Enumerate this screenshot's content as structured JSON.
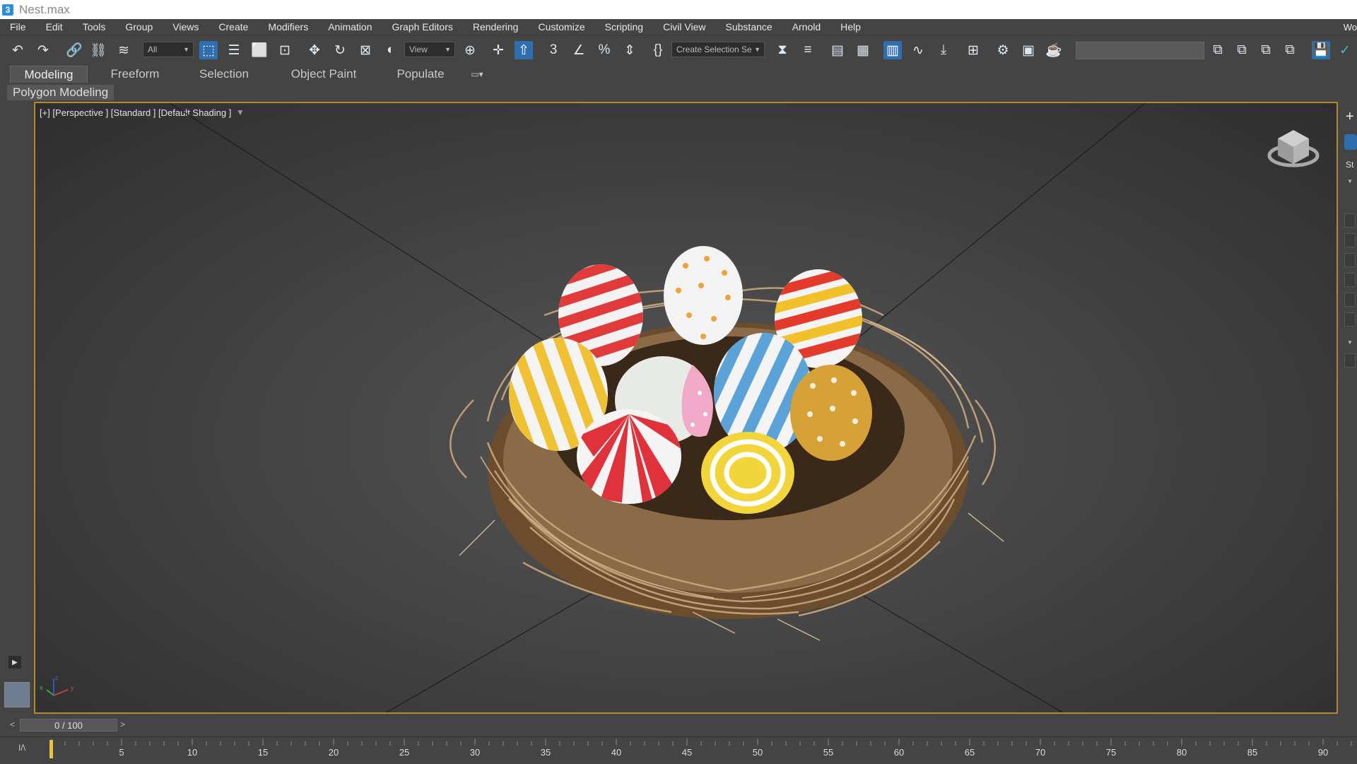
{
  "window": {
    "title": "Nest.max",
    "icon_glyph": "3"
  },
  "menu": {
    "items": [
      "File",
      "Edit",
      "Tools",
      "Group",
      "Views",
      "Create",
      "Modifiers",
      "Animation",
      "Graph Editors",
      "Rendering",
      "Customize",
      "Scripting",
      "Civil View",
      "Substance",
      "Arnold",
      "Help"
    ],
    "overflow": "Wo"
  },
  "toolbar": {
    "filter_select": "All",
    "reference_coord": "View",
    "named_selection": "Create Selection Se",
    "icons": [
      "undo-icon",
      "redo-icon",
      "link-icon",
      "unlink-icon",
      "bind-space-warp-icon",
      "select-object-icon",
      "select-by-name-icon",
      "rect-selection-region-icon",
      "window-crossing-icon",
      "select-move-icon",
      "select-rotate-icon",
      "select-scale-icon",
      "select-place-icon",
      "select-manipulate-icon",
      "keyboard-shortcut-override-icon",
      "snaps-toggle-icon",
      "angle-snap-icon",
      "percent-snap-icon",
      "spinner-snap-icon",
      "edit-named-selection-icon",
      "mirror-icon",
      "align-icon",
      "scene-explorer-icon",
      "layer-explorer-icon",
      "toggle-ribbon-icon",
      "curve-editor-icon",
      "schematic-view-icon",
      "material-editor-icon",
      "render-setup-icon",
      "rendered-frame-window-icon",
      "render-production-icon"
    ]
  },
  "ribbon": {
    "tabs": [
      "Modeling",
      "Freeform",
      "Selection",
      "Object Paint",
      "Populate"
    ],
    "active_tab": "Modeling",
    "panel_label": "Polygon Modeling"
  },
  "viewport": {
    "label": "[+] [Perspective ] [Standard ] [Default Shading ]",
    "border_color": "#b08a2e",
    "scene": "nest-with-easter-eggs",
    "axis_labels": {
      "x": "x",
      "y": "y",
      "z": "z"
    }
  },
  "right_panel": {
    "plus": "+",
    "label": "St"
  },
  "timeslider": {
    "frame_text": "0 / 100",
    "prev": "<",
    "next": ">"
  },
  "timeline": {
    "labels": [
      "5",
      "10",
      "15",
      "20",
      "25",
      "30",
      "35",
      "40",
      "45",
      "50",
      "55",
      "60",
      "65",
      "70",
      "75",
      "80",
      "85",
      "90"
    ],
    "current_frame": 0,
    "max_frame": 100
  },
  "colors": {
    "accent": "#2f6fb0",
    "viewport_border": "#b08a2e",
    "time_cursor": "#e8c43a"
  }
}
